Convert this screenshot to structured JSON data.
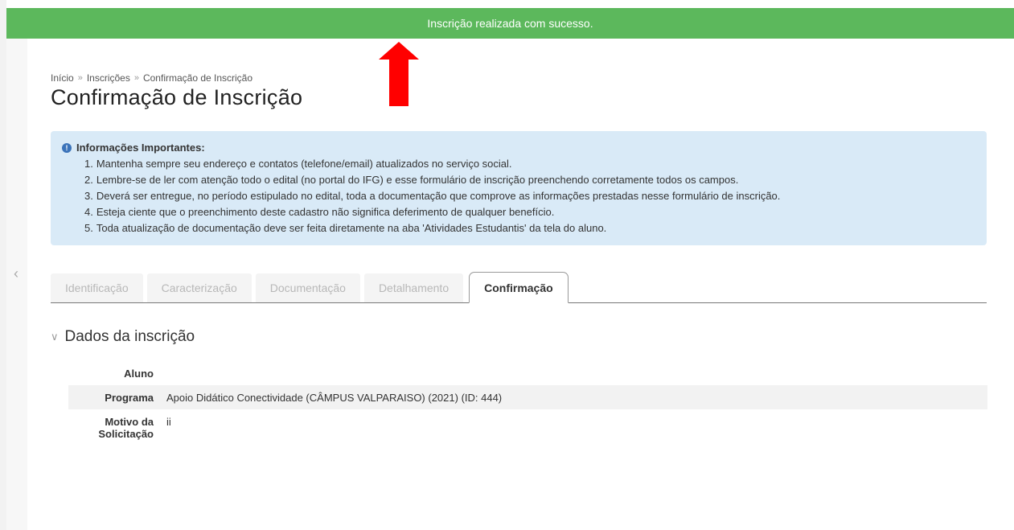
{
  "banner": {
    "message": "Inscrição realizada com sucesso."
  },
  "breadcrumb": {
    "items": [
      "Início",
      "Inscrições",
      "Confirmação de Inscrição"
    ],
    "separator": "»"
  },
  "page": {
    "title": "Confirmação de Inscrição"
  },
  "info": {
    "title": "Informações Importantes:",
    "items": [
      {
        "num": "1.",
        "text": "Mantenha sempre seu endereço e contatos (telefone/email) atualizados no serviço social."
      },
      {
        "num": "2.",
        "text": "Lembre-se de ler com atenção todo o edital (no portal do IFG) e esse formulário de inscrição preenchendo corretamente todos os campos."
      },
      {
        "num": "3.",
        "text": "Deverá ser entregue, no período estipulado no edital, toda a documentação que comprove as informações prestadas nesse formulário de inscrição."
      },
      {
        "num": "4.",
        "text": "Esteja ciente que o preenchimento deste cadastro não significa deferimento de qualquer benefício."
      },
      {
        "num": "5.",
        "text": "Toda atualização de documentação deve ser feita diretamente na aba 'Atividades Estudantis' da tela do aluno."
      }
    ]
  },
  "tabs": [
    {
      "label": "Identificação",
      "active": false
    },
    {
      "label": "Caracterização",
      "active": false
    },
    {
      "label": "Documentação",
      "active": false
    },
    {
      "label": "Detalhamento",
      "active": false
    },
    {
      "label": "Confirmação",
      "active": true
    }
  ],
  "section": {
    "title": "Dados da inscrição",
    "rows": [
      {
        "label": "Aluno",
        "value": ""
      },
      {
        "label": "Programa",
        "value": "Apoio Didático Conectividade (CÂMPUS VALPARAISO) (2021) (ID: 444)"
      },
      {
        "label_line1": "Motivo da",
        "label_line2": "Solicitação",
        "value": "ii"
      }
    ]
  },
  "colors": {
    "banner": "#5cb85c",
    "info_box": "#d9eaf7",
    "annotation_arrow": "#ff0000"
  },
  "icons": {
    "info": "info-circle-icon",
    "section_toggle": "chevron-down-icon",
    "sidebar_toggle": "chevron-left-icon",
    "annotation": "red-up-arrow"
  }
}
